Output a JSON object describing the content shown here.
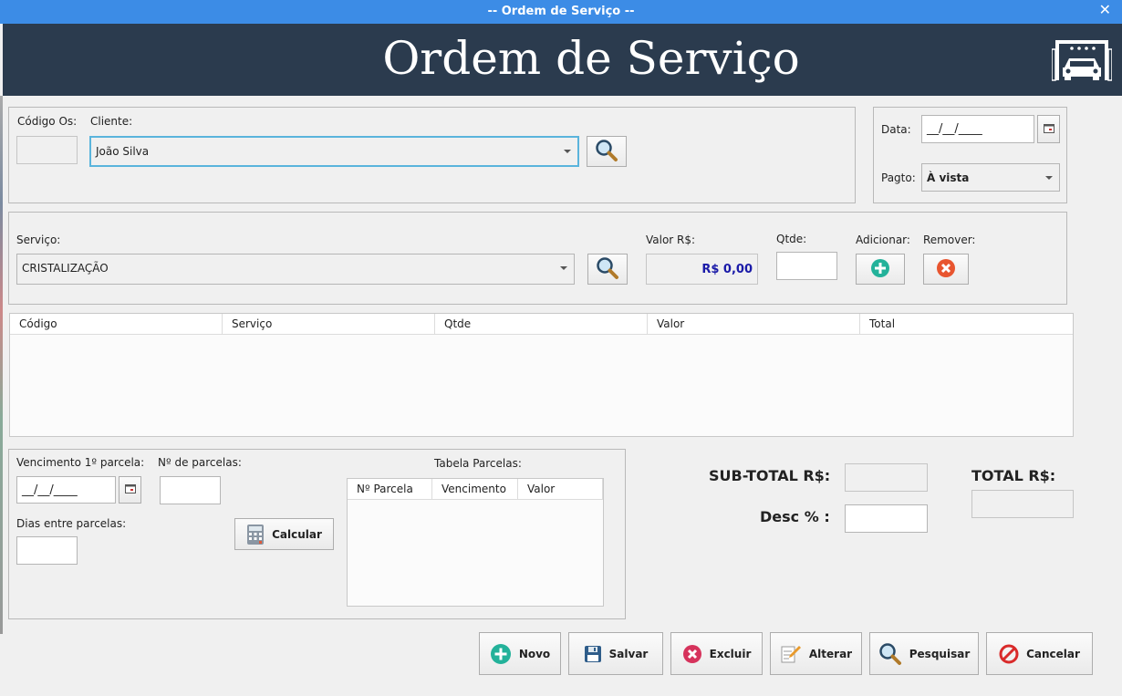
{
  "window": {
    "title": "-- Ordem de Serviço --",
    "close": "✕"
  },
  "header": {
    "title": "Ordem de Serviço",
    "logo_icon": "car-wash-icon"
  },
  "cliente": {
    "codigo_label": "Código Os:",
    "codigo_value": "",
    "cliente_label": "Cliente:",
    "cliente_value": "João Silva"
  },
  "data_box": {
    "data_label": "Data:",
    "data_value": "__/__/____",
    "pagto_label": "Pagto:",
    "pagto_value": "À vista"
  },
  "servico": {
    "servico_label": "Serviço:",
    "servico_value": "CRISTALIZAÇÃO",
    "valor_label": "Valor R$:",
    "valor_value": "R$ 0,00",
    "qtde_label": "Qtde:",
    "qtde_value": "",
    "adicionar_label": "Adicionar:",
    "remover_label": "Remover:"
  },
  "items_table": {
    "columns": [
      "Código",
      "Serviço",
      "Qtde",
      "Valor",
      "Total"
    ]
  },
  "parcelas": {
    "vencimento_label": "Vencimento 1º parcela:",
    "vencimento_value": "__/__/____",
    "num_parcelas_label": "Nº de parcelas:",
    "num_parcelas_value": "",
    "dias_label": "Dias entre parcelas:",
    "dias_value": "",
    "calcular_label": "Calcular",
    "tabela_label": "Tabela Parcelas:",
    "tabela_columns": [
      "Nº Parcela",
      "Vencimento",
      "Valor"
    ]
  },
  "totals": {
    "subtotal_label": "SUB-TOTAL R$:",
    "subtotal_value": "",
    "desc_label": "Desc % :",
    "desc_value": "",
    "total_label": "TOTAL R$:",
    "total_value": ""
  },
  "actions": {
    "novo": "Novo",
    "salvar": "Salvar",
    "excluir": "Excluir",
    "alterar": "Alterar",
    "pesquisar": "Pesquisar",
    "cancelar": "Cancelar"
  },
  "colors": {
    "titlebar": "#3c8ce6",
    "header": "#2b3b4e",
    "price": "#1a1aa8",
    "add": "#23b29a",
    "remove": "#e8552f"
  }
}
